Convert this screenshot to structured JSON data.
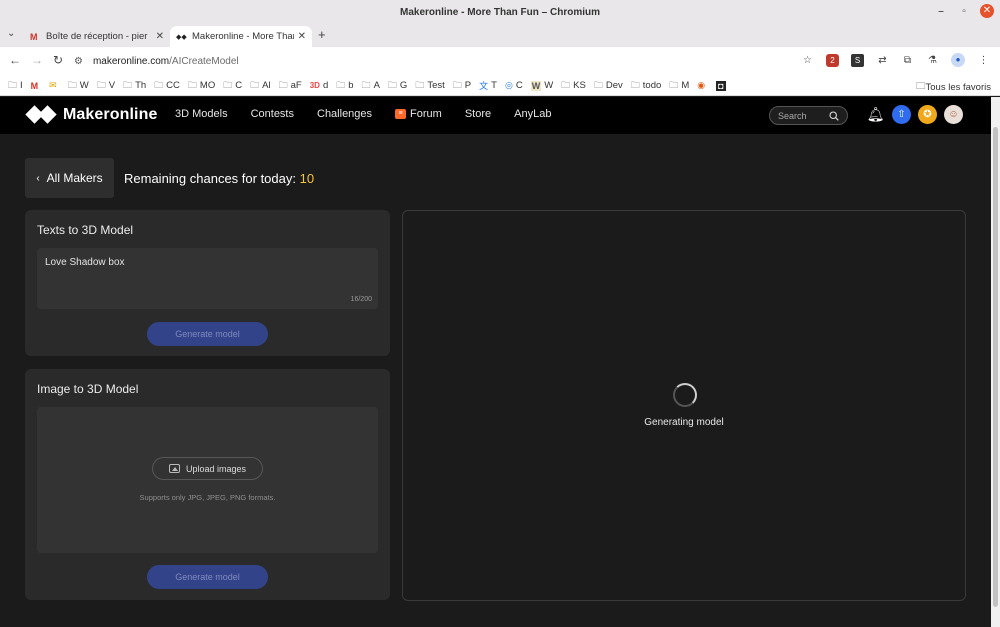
{
  "window": {
    "title": "Makeronline - More Than Fun – Chromium",
    "controls": {
      "minimize": "–",
      "maximize": "▫",
      "close": "✕"
    }
  },
  "tabs": [
    {
      "label": "Boîte de réception - pier",
      "icon": "gmail-icon",
      "favicon": "M"
    },
    {
      "label": "Makeronline - More Than",
      "icon": "makeronline-icon",
      "favicon": "◆◆"
    }
  ],
  "tab_close": "✕",
  "new_tab": "+",
  "address_bar": {
    "domain": "makeronline.com",
    "path": "/AICreateModel"
  },
  "bookmarks": [
    {
      "label": "I",
      "icon": "folder-icon"
    },
    {
      "label": "",
      "icon": "gmail-icon"
    },
    {
      "label": "",
      "icon": "mail-icon"
    },
    {
      "label": "W",
      "icon": "folder-icon"
    },
    {
      "label": "V",
      "icon": "folder-icon"
    },
    {
      "label": "Th",
      "icon": "folder-icon"
    },
    {
      "label": "CC",
      "icon": "folder-icon"
    },
    {
      "label": "MO",
      "icon": "folder-icon"
    },
    {
      "label": "C",
      "icon": "folder-icon"
    },
    {
      "label": "Al",
      "icon": "folder-icon"
    },
    {
      "label": "aF",
      "icon": "folder-icon"
    },
    {
      "label": "d",
      "icon": "3d-icon"
    },
    {
      "label": "b",
      "icon": "folder-icon"
    },
    {
      "label": "A",
      "icon": "folder-icon"
    },
    {
      "label": "G",
      "icon": "folder-icon"
    },
    {
      "label": "Test",
      "icon": "folder-icon"
    },
    {
      "label": "P",
      "icon": "folder-icon"
    },
    {
      "label": "T",
      "icon": "translate-icon"
    },
    {
      "label": "C",
      "icon": "copilot-icon"
    },
    {
      "label": "W",
      "icon": "wiki-icon"
    },
    {
      "label": "KS",
      "icon": "folder-icon"
    },
    {
      "label": "Dev",
      "icon": "folder-icon"
    },
    {
      "label": "todo",
      "icon": "folder-icon"
    },
    {
      "label": "M",
      "icon": "folder-icon"
    },
    {
      "label": "",
      "icon": "firefox-icon"
    },
    {
      "label": "",
      "icon": "app-icon"
    }
  ],
  "all_bookmarks": "Tous les favoris",
  "site": {
    "brand": "Makeronline",
    "nav": [
      "3D Models",
      "Contests",
      "Challenges",
      "Forum",
      "Store",
      "AnyLab"
    ],
    "search_placeholder": "Search"
  },
  "page": {
    "back_label": "All Makers",
    "remaining_label": "Remaining chances for today: ",
    "remaining_count": "10",
    "text_panel": {
      "title": "Texts to 3D Model",
      "prompt": "Love Shadow box",
      "counter": "16/200",
      "button": "Generate model"
    },
    "image_panel": {
      "title": "Image to 3D Model",
      "upload_button": "Upload images",
      "hint": "Supports only JPG, JPEG, PNG formats.",
      "button": "Generate model"
    },
    "preview": {
      "status": "Generating model"
    }
  },
  "colors": {
    "accent_yellow": "#f5c33b",
    "button_blue": "#33438a",
    "header_bg": "#000000",
    "page_bg": "#1b1b1b",
    "panel_bg": "#2a2a2a"
  }
}
